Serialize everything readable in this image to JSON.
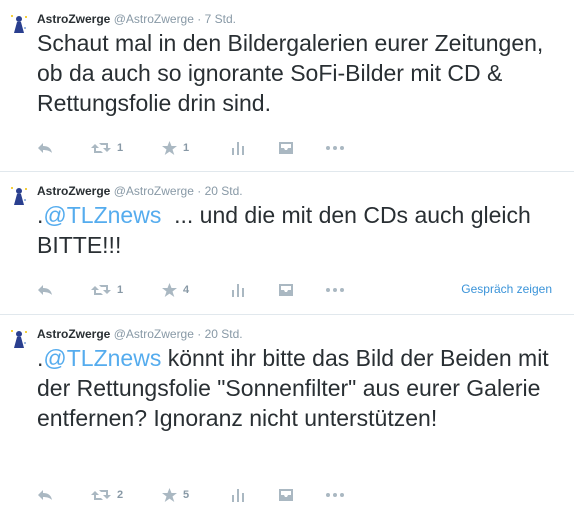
{
  "tweets": [
    {
      "name": "AstroZwerge",
      "handle": "@AstroZwerge",
      "sep": "·",
      "time": "7 Std.",
      "prefix": "",
      "mention": "",
      "text": "Schaut mal in den Bildergalerien eurer Zeitungen, ob da auch so ignorante SoFi-Bilder mit CD & Rettungsfolie drin sind.",
      "retweets": "1",
      "favorites": "1",
      "conversation": ""
    },
    {
      "name": "AstroZwerge",
      "handle": "@AstroZwerge",
      "sep": "·",
      "time": "20 Std.",
      "prefix": ".",
      "mention": "@TLZnews",
      "text": "  ... und die mit den CDs auch gleich BITTE!!!",
      "retweets": "1",
      "favorites": "4",
      "conversation": "Gespräch zeigen"
    },
    {
      "name": "AstroZwerge",
      "handle": "@AstroZwerge",
      "sep": "·",
      "time": "20 Std.",
      "prefix": ".",
      "mention": "@TLZnews",
      "text": " könnt ihr bitte das Bild der Beiden mit der Rettungsfolie \"Sonnenfilter\" aus eurer Galerie entfernen? Ignoranz nicht unterstützen!",
      "retweets": "2",
      "favorites": "5",
      "conversation": ""
    }
  ],
  "icons": [
    "reply-icon",
    "retweet-icon",
    "favorite-icon",
    "analytics-icon",
    "inbox-icon",
    "more-icon"
  ],
  "colors": {
    "accent": "#55acee",
    "muted": "#8899a6",
    "icon": "#aab8c2",
    "link": "#3b94d9"
  }
}
